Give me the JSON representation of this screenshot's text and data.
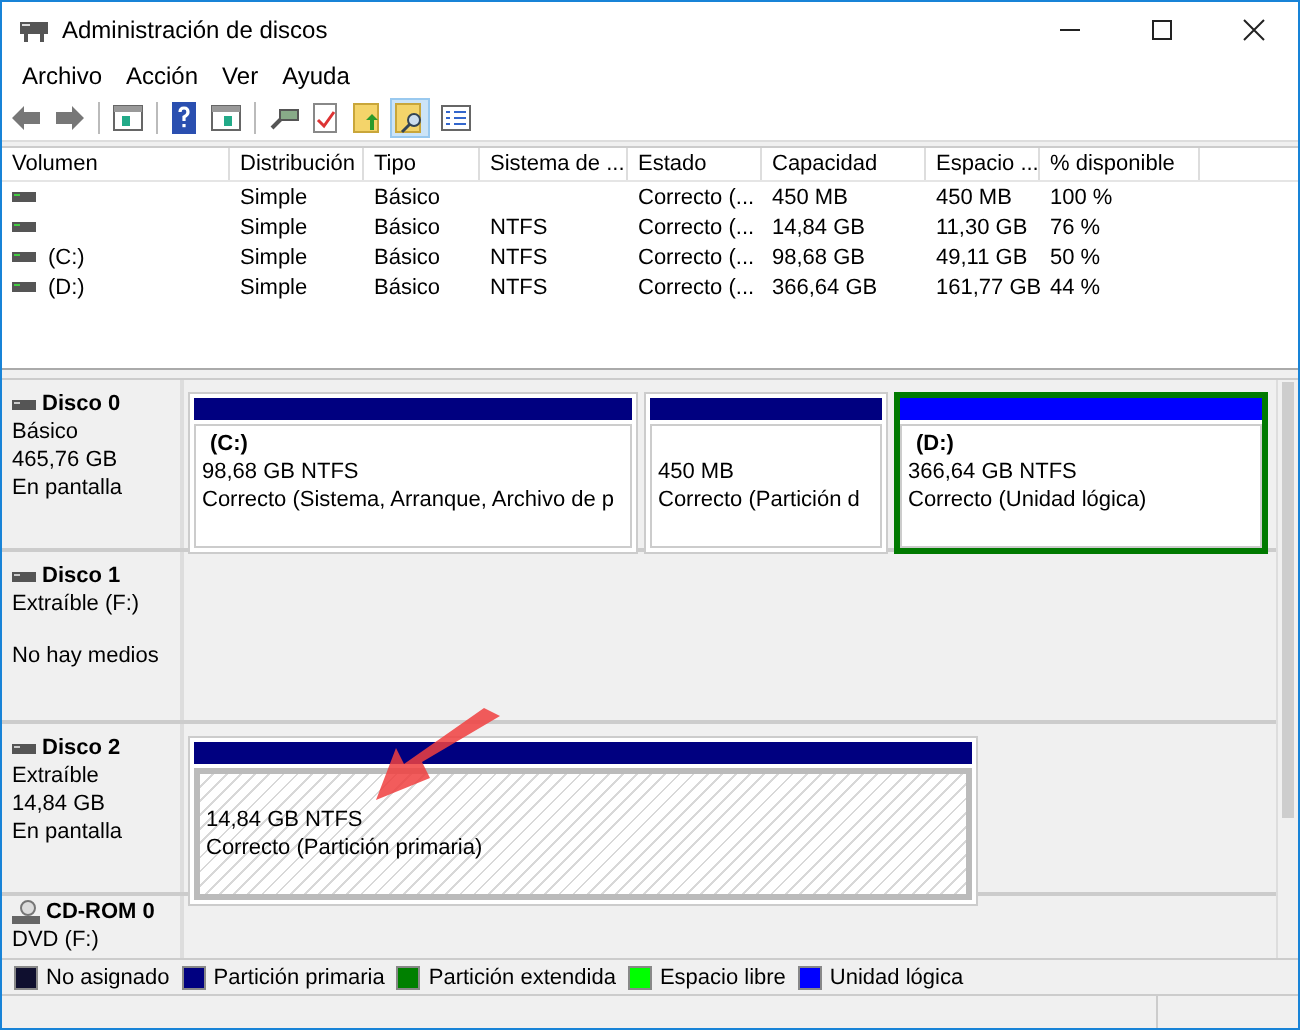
{
  "window": {
    "title": "Administración de discos"
  },
  "menu": [
    "Archivo",
    "Acción",
    "Ver",
    "Ayuda"
  ],
  "volumes": {
    "columns": [
      "Volumen",
      "Distribución",
      "Tipo",
      "Sistema de ...",
      "Estado",
      "Capacidad",
      "Espacio ...",
      "% disponible"
    ],
    "rows": [
      {
        "cells": [
          "",
          "Simple",
          "Básico",
          "",
          "Correcto (...",
          "450 MB",
          "450 MB",
          "100 %"
        ]
      },
      {
        "cells": [
          "",
          "Simple",
          "Básico",
          "NTFS",
          "Correcto (...",
          "14,84 GB",
          "11,30 GB",
          "76 %"
        ]
      },
      {
        "cells": [
          "(C:)",
          "Simple",
          "Básico",
          "NTFS",
          "Correcto (...",
          "98,68 GB",
          "49,11 GB",
          "50 %"
        ]
      },
      {
        "cells": [
          "(D:)",
          "Simple",
          "Básico",
          "NTFS",
          "Correcto (...",
          "366,64 GB",
          "161,77 GB",
          "44 %"
        ]
      }
    ]
  },
  "disks": [
    {
      "kind": "disk",
      "title": "Disco 0",
      "lines": [
        "Básico",
        "465,76 GB",
        "En pantalla"
      ],
      "partitions": [
        {
          "name": "(C:)",
          "size": "98,68 GB NTFS",
          "status": "Correcto (Sistema, Arranque, Archivo de p",
          "color": "#000080",
          "focused": false,
          "selected": false
        },
        {
          "size": "450 MB",
          "status": "Correcto (Partición d",
          "color": "#000080",
          "focused": false,
          "selected": false
        },
        {
          "name": "(D:)",
          "size": "366,64 GB NTFS",
          "status": "Correcto (Unidad lógica)",
          "color": "#0000ff",
          "focused": true,
          "selected": false
        }
      ]
    },
    {
      "kind": "disk",
      "title": "Disco 1",
      "lines": [
        "Extraíble (F:)",
        "No hay medios"
      ]
    },
    {
      "kind": "disk",
      "title": "Disco 2",
      "lines": [
        "Extraíble",
        "14,84 GB",
        "En pantalla"
      ],
      "partitions": [
        {
          "size": "14,84 GB NTFS",
          "status": "Correcto (Partición primaria)",
          "color": "#000080",
          "focused": false,
          "selected": true
        }
      ]
    },
    {
      "kind": "cdrom",
      "title": "CD-ROM 0",
      "lines": [
        "DVD (F:)"
      ]
    }
  ],
  "legend": [
    {
      "label": "No asignado",
      "color": "#0f0f2f"
    },
    {
      "label": "Partición primaria",
      "color": "#000080"
    },
    {
      "label": "Partición extendida",
      "color": "#008000"
    },
    {
      "label": "Espacio libre",
      "color": "#00ff00"
    },
    {
      "label": "Unidad lógica",
      "color": "#0000ff"
    }
  ]
}
